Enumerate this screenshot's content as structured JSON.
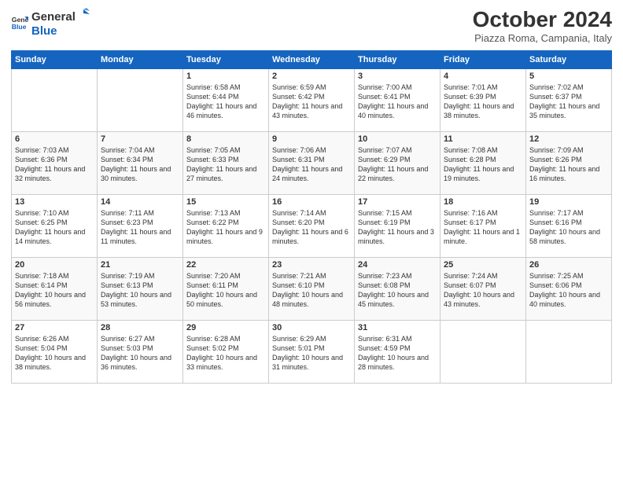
{
  "logo": {
    "general": "General",
    "blue": "Blue"
  },
  "title": "October 2024",
  "subtitle": "Piazza Roma, Campania, Italy",
  "headers": [
    "Sunday",
    "Monday",
    "Tuesday",
    "Wednesday",
    "Thursday",
    "Friday",
    "Saturday"
  ],
  "weeks": [
    [
      {
        "day": "",
        "sunrise": "",
        "sunset": "",
        "daylight": ""
      },
      {
        "day": "",
        "sunrise": "",
        "sunset": "",
        "daylight": ""
      },
      {
        "day": "1",
        "sunrise": "Sunrise: 6:58 AM",
        "sunset": "Sunset: 6:44 PM",
        "daylight": "Daylight: 11 hours and 46 minutes."
      },
      {
        "day": "2",
        "sunrise": "Sunrise: 6:59 AM",
        "sunset": "Sunset: 6:42 PM",
        "daylight": "Daylight: 11 hours and 43 minutes."
      },
      {
        "day": "3",
        "sunrise": "Sunrise: 7:00 AM",
        "sunset": "Sunset: 6:41 PM",
        "daylight": "Daylight: 11 hours and 40 minutes."
      },
      {
        "day": "4",
        "sunrise": "Sunrise: 7:01 AM",
        "sunset": "Sunset: 6:39 PM",
        "daylight": "Daylight: 11 hours and 38 minutes."
      },
      {
        "day": "5",
        "sunrise": "Sunrise: 7:02 AM",
        "sunset": "Sunset: 6:37 PM",
        "daylight": "Daylight: 11 hours and 35 minutes."
      }
    ],
    [
      {
        "day": "6",
        "sunrise": "Sunrise: 7:03 AM",
        "sunset": "Sunset: 6:36 PM",
        "daylight": "Daylight: 11 hours and 32 minutes."
      },
      {
        "day": "7",
        "sunrise": "Sunrise: 7:04 AM",
        "sunset": "Sunset: 6:34 PM",
        "daylight": "Daylight: 11 hours and 30 minutes."
      },
      {
        "day": "8",
        "sunrise": "Sunrise: 7:05 AM",
        "sunset": "Sunset: 6:33 PM",
        "daylight": "Daylight: 11 hours and 27 minutes."
      },
      {
        "day": "9",
        "sunrise": "Sunrise: 7:06 AM",
        "sunset": "Sunset: 6:31 PM",
        "daylight": "Daylight: 11 hours and 24 minutes."
      },
      {
        "day": "10",
        "sunrise": "Sunrise: 7:07 AM",
        "sunset": "Sunset: 6:29 PM",
        "daylight": "Daylight: 11 hours and 22 minutes."
      },
      {
        "day": "11",
        "sunrise": "Sunrise: 7:08 AM",
        "sunset": "Sunset: 6:28 PM",
        "daylight": "Daylight: 11 hours and 19 minutes."
      },
      {
        "day": "12",
        "sunrise": "Sunrise: 7:09 AM",
        "sunset": "Sunset: 6:26 PM",
        "daylight": "Daylight: 11 hours and 16 minutes."
      }
    ],
    [
      {
        "day": "13",
        "sunrise": "Sunrise: 7:10 AM",
        "sunset": "Sunset: 6:25 PM",
        "daylight": "Daylight: 11 hours and 14 minutes."
      },
      {
        "day": "14",
        "sunrise": "Sunrise: 7:11 AM",
        "sunset": "Sunset: 6:23 PM",
        "daylight": "Daylight: 11 hours and 11 minutes."
      },
      {
        "day": "15",
        "sunrise": "Sunrise: 7:13 AM",
        "sunset": "Sunset: 6:22 PM",
        "daylight": "Daylight: 11 hours and 9 minutes."
      },
      {
        "day": "16",
        "sunrise": "Sunrise: 7:14 AM",
        "sunset": "Sunset: 6:20 PM",
        "daylight": "Daylight: 11 hours and 6 minutes."
      },
      {
        "day": "17",
        "sunrise": "Sunrise: 7:15 AM",
        "sunset": "Sunset: 6:19 PM",
        "daylight": "Daylight: 11 hours and 3 minutes."
      },
      {
        "day": "18",
        "sunrise": "Sunrise: 7:16 AM",
        "sunset": "Sunset: 6:17 PM",
        "daylight": "Daylight: 11 hours and 1 minute."
      },
      {
        "day": "19",
        "sunrise": "Sunrise: 7:17 AM",
        "sunset": "Sunset: 6:16 PM",
        "daylight": "Daylight: 10 hours and 58 minutes."
      }
    ],
    [
      {
        "day": "20",
        "sunrise": "Sunrise: 7:18 AM",
        "sunset": "Sunset: 6:14 PM",
        "daylight": "Daylight: 10 hours and 56 minutes."
      },
      {
        "day": "21",
        "sunrise": "Sunrise: 7:19 AM",
        "sunset": "Sunset: 6:13 PM",
        "daylight": "Daylight: 10 hours and 53 minutes."
      },
      {
        "day": "22",
        "sunrise": "Sunrise: 7:20 AM",
        "sunset": "Sunset: 6:11 PM",
        "daylight": "Daylight: 10 hours and 50 minutes."
      },
      {
        "day": "23",
        "sunrise": "Sunrise: 7:21 AM",
        "sunset": "Sunset: 6:10 PM",
        "daylight": "Daylight: 10 hours and 48 minutes."
      },
      {
        "day": "24",
        "sunrise": "Sunrise: 7:23 AM",
        "sunset": "Sunset: 6:08 PM",
        "daylight": "Daylight: 10 hours and 45 minutes."
      },
      {
        "day": "25",
        "sunrise": "Sunrise: 7:24 AM",
        "sunset": "Sunset: 6:07 PM",
        "daylight": "Daylight: 10 hours and 43 minutes."
      },
      {
        "day": "26",
        "sunrise": "Sunrise: 7:25 AM",
        "sunset": "Sunset: 6:06 PM",
        "daylight": "Daylight: 10 hours and 40 minutes."
      }
    ],
    [
      {
        "day": "27",
        "sunrise": "Sunrise: 6:26 AM",
        "sunset": "Sunset: 5:04 PM",
        "daylight": "Daylight: 10 hours and 38 minutes."
      },
      {
        "day": "28",
        "sunrise": "Sunrise: 6:27 AM",
        "sunset": "Sunset: 5:03 PM",
        "daylight": "Daylight: 10 hours and 36 minutes."
      },
      {
        "day": "29",
        "sunrise": "Sunrise: 6:28 AM",
        "sunset": "Sunset: 5:02 PM",
        "daylight": "Daylight: 10 hours and 33 minutes."
      },
      {
        "day": "30",
        "sunrise": "Sunrise: 6:29 AM",
        "sunset": "Sunset: 5:01 PM",
        "daylight": "Daylight: 10 hours and 31 minutes."
      },
      {
        "day": "31",
        "sunrise": "Sunrise: 6:31 AM",
        "sunset": "Sunset: 4:59 PM",
        "daylight": "Daylight: 10 hours and 28 minutes."
      },
      {
        "day": "",
        "sunrise": "",
        "sunset": "",
        "daylight": ""
      },
      {
        "day": "",
        "sunrise": "",
        "sunset": "",
        "daylight": ""
      }
    ]
  ]
}
